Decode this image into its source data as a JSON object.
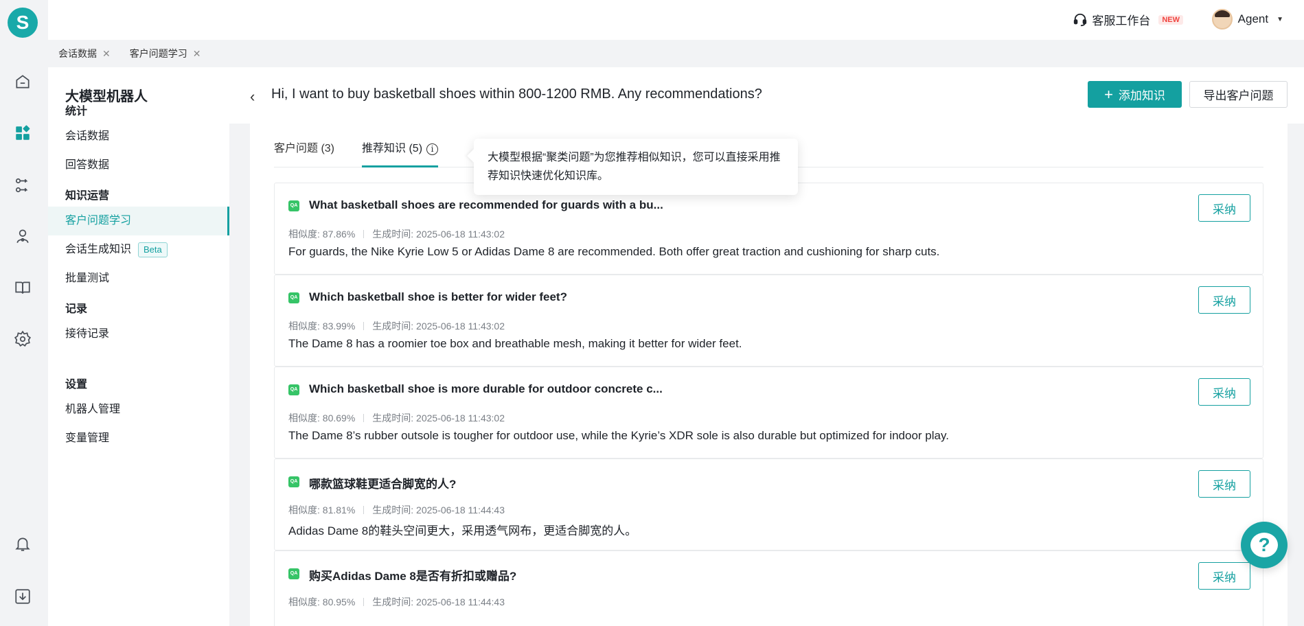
{
  "app": {
    "logo_letter": "S"
  },
  "topbar": {
    "workbench_label": "客服工作台",
    "new_badge": "NEW",
    "user_name": "Agent"
  },
  "tabstrip": [
    {
      "label": "会话数据",
      "close": "✕"
    },
    {
      "label": "客户问题学习",
      "close": "✕"
    }
  ],
  "subnav": {
    "title": "大模型机器人",
    "groups": [
      {
        "heading": "统计",
        "items": [
          "会话数据",
          "回答数据"
        ]
      },
      {
        "heading": "知识运营",
        "items": [
          "客户问题学习",
          "会话生成知识",
          "批量测试"
        ],
        "beta": "Beta"
      },
      {
        "heading": "记录",
        "items": [
          "接待记录"
        ]
      },
      {
        "heading": "设置",
        "items": [
          "机器人管理",
          "变量管理"
        ]
      }
    ]
  },
  "header": {
    "title": "Hi, I want to buy basketball shoes within 800-1200 RMB. Any recommendations?",
    "add_button": "添加知识",
    "export_button": "导出客户问题"
  },
  "tabs": {
    "customer_questions": "客户问题 (3)",
    "recommended": "推荐知识 (5)"
  },
  "tooltip": "大模型根据“聚类问题”为您推荐相似知识，您可以直接采用推荐知识快速优化知识库。",
  "labels": {
    "similarity": "相似度:",
    "generated": "生成时间:",
    "adopt": "采纳",
    "qa": "QA"
  },
  "items": [
    {
      "title": "What basketball shoes are recommended for guards with a bu...",
      "similarity": "87.86%",
      "time": "2025-06-18 11:43:02",
      "answer": "For guards, the Nike Kyrie Low 5 or Adidas Dame 8 are recommended. Both offer great traction and cushioning for sharp cuts."
    },
    {
      "title": "Which basketball shoe is better for wider feet?",
      "similarity": "83.99%",
      "time": "2025-06-18 11:43:02",
      "answer": "The Dame 8 has a roomier toe box and breathable mesh, making it better for wider feet."
    },
    {
      "title": "Which basketball shoe is more durable for outdoor concrete c...",
      "similarity": "80.69%",
      "time": "2025-06-18 11:43:02",
      "answer": "The Dame 8’s rubber outsole is tougher for outdoor use, while the Kyrie’s XDR sole is also durable but optimized for indoor play."
    },
    {
      "title": "哪款篮球鞋更适合脚宽的人?",
      "similarity": "81.81%",
      "time": "2025-06-18 11:44:43",
      "answer": "Adidas Dame 8的鞋头空间更大，采用透气网布，更适合脚宽的人。"
    },
    {
      "title": "购买Adidas Dame 8是否有折扣或赠品?",
      "similarity": "80.95%",
      "time": "2025-06-18 11:44:43",
      "answer": ""
    }
  ],
  "help_fab": "?"
}
